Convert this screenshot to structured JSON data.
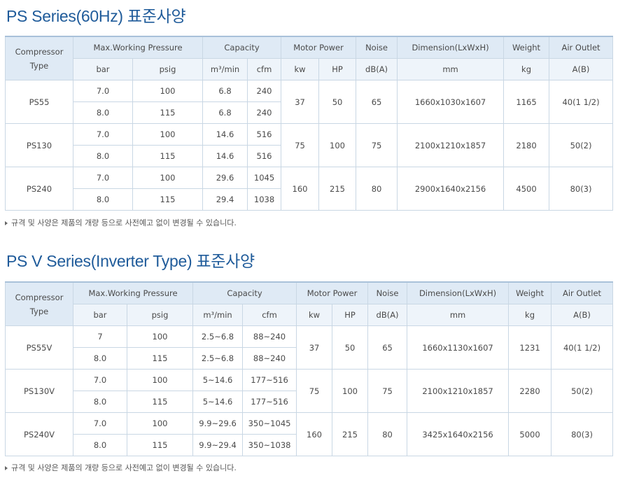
{
  "sections": [
    {
      "title": "PS Series(60Hz) 표준사양",
      "headers": {
        "compressor_type": "Compressor\nType",
        "pressure": "Max.Working Pressure",
        "capacity": "Capacity",
        "motor": "Motor Power",
        "noise": "Noise",
        "dimension": "Dimension(LxWxH)",
        "weight": "Weight",
        "outlet": "Air Outlet"
      },
      "units": {
        "bar": "bar",
        "psig": "psig",
        "m3min": "m³/min",
        "cfm": "cfm",
        "kw": "kw",
        "hp": "HP",
        "db": "dB(A)",
        "mm": "mm",
        "kg": "kg",
        "ab": "A(B)"
      },
      "models": [
        {
          "name": "PS55",
          "rows": [
            {
              "bar": "7.0",
              "psig": "100",
              "m3min": "6.8",
              "cfm": "240"
            },
            {
              "bar": "8.0",
              "psig": "115",
              "m3min": "6.8",
              "cfm": "240"
            }
          ],
          "kw": "37",
          "hp": "50",
          "noise": "65",
          "dimension": "1660x1030x1607",
          "weight": "1165",
          "outlet": "40(1 1/2)"
        },
        {
          "name": "PS130",
          "rows": [
            {
              "bar": "7.0",
              "psig": "100",
              "m3min": "14.6",
              "cfm": "516"
            },
            {
              "bar": "8.0",
              "psig": "115",
              "m3min": "14.6",
              "cfm": "516"
            }
          ],
          "kw": "75",
          "hp": "100",
          "noise": "75",
          "dimension": "2100x1210x1857",
          "weight": "2180",
          "outlet": "50(2)"
        },
        {
          "name": "PS240",
          "rows": [
            {
              "bar": "7.0",
              "psig": "100",
              "m3min": "29.6",
              "cfm": "1045"
            },
            {
              "bar": "8.0",
              "psig": "115",
              "m3min": "29.4",
              "cfm": "1038"
            }
          ],
          "kw": "160",
          "hp": "215",
          "noise": "80",
          "dimension": "2900x1640x2156",
          "weight": "4500",
          "outlet": "80(3)"
        }
      ],
      "note": "규격 및 사양은 제품의 개량 등으로 사전예고 없이 변경될 수 있습니다."
    },
    {
      "title": "PS V Series(Inverter Type) 표준사양",
      "headers": {
        "compressor_type": "Compressor\nType",
        "pressure": "Max.Working Pressure",
        "capacity": "Capacity",
        "motor": "Motor Power",
        "noise": "Noise",
        "dimension": "Dimension(LxWxH)",
        "weight": "Weight",
        "outlet": "Air Outlet"
      },
      "units": {
        "bar": "bar",
        "psig": "psig",
        "m3min": "m³/min",
        "cfm": "cfm",
        "kw": "kw",
        "hp": "HP",
        "db": "dB(A)",
        "mm": "mm",
        "kg": "kg",
        "ab": "A(B)"
      },
      "models": [
        {
          "name": "PS55V",
          "rows": [
            {
              "bar": "7",
              "psig": "100",
              "m3min": "2.5~6.8",
              "cfm": "88~240"
            },
            {
              "bar": "8.0",
              "psig": "115",
              "m3min": "2.5~6.8",
              "cfm": "88~240"
            }
          ],
          "kw": "37",
          "hp": "50",
          "noise": "65",
          "dimension": "1660x1130x1607",
          "weight": "1231",
          "outlet": "40(1 1/2)"
        },
        {
          "name": "PS130V",
          "rows": [
            {
              "bar": "7.0",
              "psig": "100",
              "m3min": "5~14.6",
              "cfm": "177~516"
            },
            {
              "bar": "8.0",
              "psig": "115",
              "m3min": "5~14.6",
              "cfm": "177~516"
            }
          ],
          "kw": "75",
          "hp": "100",
          "noise": "75",
          "dimension": "2100x1210x1857",
          "weight": "2280",
          "outlet": "50(2)"
        },
        {
          "name": "PS240V",
          "rows": [
            {
              "bar": "7.0",
              "psig": "100",
              "m3min": "9.9~29.6",
              "cfm": "350~1045"
            },
            {
              "bar": "8.0",
              "psig": "115",
              "m3min": "9.9~29.4",
              "cfm": "350~1038"
            }
          ],
          "kw": "160",
          "hp": "215",
          "noise": "80",
          "dimension": "3425x1640x2156",
          "weight": "5000",
          "outlet": "80(3)"
        }
      ],
      "note": "규격 및 사양은 제품의 개량 등으로 사전예고 없이 변경될 수 있습니다."
    }
  ]
}
